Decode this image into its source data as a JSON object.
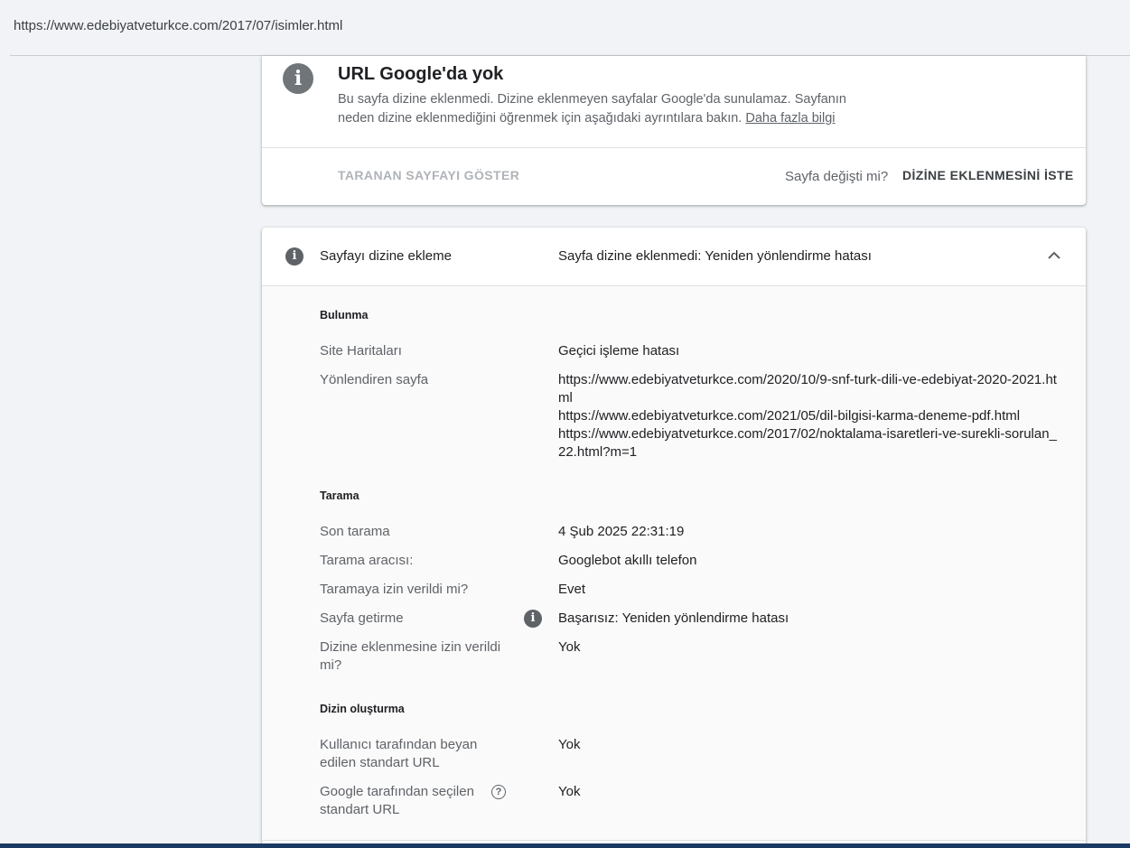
{
  "address_bar": {
    "url": "https://www.edebiyatveturkce.com/2017/07/isimler.html"
  },
  "status_card": {
    "icon": "info-icon",
    "title": "URL Google'da yok",
    "description": "Bu sayfa dizine eklenmedi. Dizine eklenmeyen sayfalar Google'da sunulamaz. Sayfanın neden dizine eklenmediğini öğrenmek için aşağıdaki ayrıntılara bakın.",
    "learn_more": "Daha fazla bilgi",
    "show_crawled_label": "TARANAN SAYFAYI GÖSTER",
    "page_changed_question": "Sayfa değişti mi?",
    "request_indexing_label": "DİZİNE EKLENMESİNİ İSTE"
  },
  "indexing_panel": {
    "icon": "info-icon",
    "label": "Sayfayı dizine ekleme",
    "status": "Sayfa dizine eklenmedi: Yeniden yönlendirme hatası",
    "discovery": {
      "title": "Bulunma",
      "sitemaps_label": "Site Haritaları",
      "sitemaps_value": "Geçici işleme hatası",
      "referring_label": "Yönlendiren sayfa",
      "referring_pages": [
        "https://www.edebiyatveturkce.com/2020/10/9-snf-turk-dili-ve-edebiyat-2020-2021.html",
        "https://www.edebiyatveturkce.com/2021/05/dil-bilgisi-karma-deneme-pdf.html",
        "https://www.edebiyatveturkce.com/2017/02/noktalama-isaretleri-ve-surekli-sorulan_22.html?m=1"
      ]
    },
    "crawl": {
      "title": "Tarama",
      "last_crawl_label": "Son tarama",
      "last_crawl_value": "4 Şub 2025 22:31:19",
      "crawled_as_label": "Tarama aracısı:",
      "crawled_as_value": "Googlebot akıllı telefon",
      "crawl_allowed_label": "Taramaya izin verildi mi?",
      "crawl_allowed_value": "Evet",
      "page_fetch_label": "Sayfa getirme",
      "page_fetch_value": "Başarısız: Yeniden yönlendirme hatası",
      "indexing_allowed_label": "Dizine eklenmesine izin verildi mi?",
      "indexing_allowed_value": "Yok"
    },
    "indexing": {
      "title": "Dizin oluşturma",
      "user_canonical_label": "Kullanıcı tarafından beyan edilen standart URL",
      "user_canonical_value": "Yok",
      "google_canonical_label": "Google tarafından seçilen standart URL",
      "google_canonical_value": "Yok"
    }
  }
}
